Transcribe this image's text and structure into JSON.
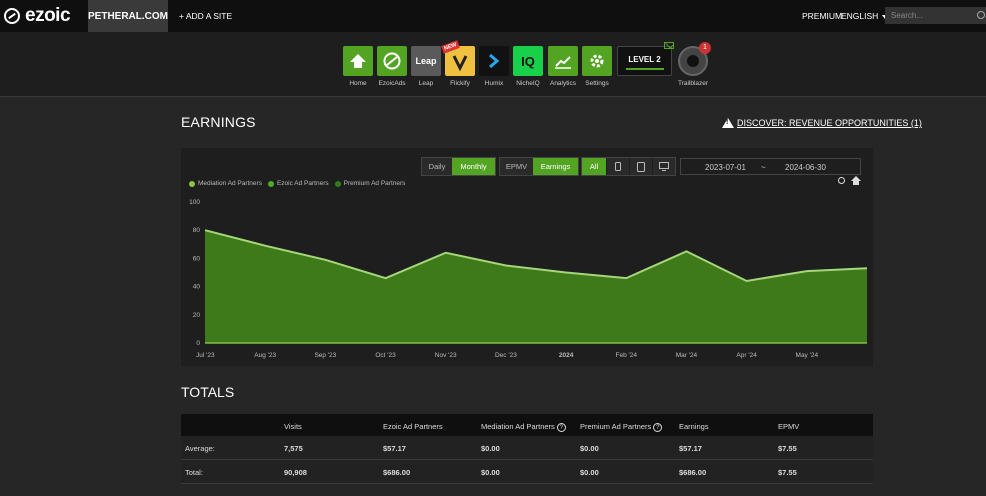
{
  "topbar": {
    "brand": "ezoic",
    "site": "PETHERAL.COM",
    "add_site": "+ ADD A SITE",
    "premium": "PREMIUM",
    "language": "ENGLISH",
    "search_placeholder": "Search..."
  },
  "apps": [
    {
      "label": "Home",
      "icon": "home-icon"
    },
    {
      "label": "EzoicAds",
      "icon": "ezoicads-icon"
    },
    {
      "label": "Leap",
      "icon": "leap-icon",
      "text": "Leap"
    },
    {
      "label": "Flickify",
      "icon": "flickify-icon",
      "badge": "NEW"
    },
    {
      "label": "Humix",
      "icon": "humix-icon"
    },
    {
      "label": "NicheIQ",
      "icon": "nicheiq-icon",
      "text": "IQ"
    },
    {
      "label": "Analytics",
      "icon": "analytics-icon"
    },
    {
      "label": "Settings",
      "icon": "gear-icon"
    }
  ],
  "level": {
    "text": "LEVEL 2"
  },
  "trailblazer": {
    "label": "Trailblazer",
    "badge": "1"
  },
  "earnings": {
    "title": "EARNINGS",
    "discover": "DISCOVER: REVENUE OPPORTUNITIES (1)",
    "controls": {
      "daily": "Daily",
      "monthly": "Monthly",
      "epmv": "EPMV",
      "earnings": "Earnings",
      "all": "All"
    },
    "date_start": "2023-07-01",
    "date_sep": "~",
    "date_end": "2024-06-30",
    "accent": "#54a424"
  },
  "chart_data": {
    "type": "area",
    "categories": [
      "Jul '23",
      "Aug '23",
      "Sep '23",
      "Oct '23",
      "Nov '23",
      "Dec '23",
      "2024",
      "Feb '24",
      "Mar '24",
      "Apr '24",
      "May '24",
      ""
    ],
    "series": [
      {
        "name": "Mediation Ad Partners",
        "color": "#8bc34a",
        "values": [
          0,
          0,
          0,
          0,
          0,
          0,
          0,
          0,
          0,
          0,
          0,
          0
        ]
      },
      {
        "name": "Ezoic Ad Partners",
        "color": "#4caf2a",
        "values": [
          80,
          69,
          59,
          46,
          64,
          55,
          50,
          46,
          65,
          44,
          51,
          53
        ]
      },
      {
        "name": "Premium Ad Partners",
        "color": "#2e7d1e",
        "values": [
          0,
          0,
          0,
          0,
          0,
          0,
          0,
          0,
          0,
          0,
          0,
          0
        ]
      }
    ],
    "yticks": [
      0,
      20,
      40,
      60,
      80,
      100
    ],
    "ylim": [
      0,
      100
    ]
  },
  "totals": {
    "title": "TOTALS",
    "headers": [
      "",
      "Visits",
      "Ezoic Ad Partners",
      "Mediation Ad Partners",
      "Premium Ad Partners",
      "Earnings",
      "EPMV"
    ],
    "rows": [
      [
        "Average:",
        "7,575",
        "$57.17",
        "$0.00",
        "$0.00",
        "$57.17",
        "$7.55"
      ],
      [
        "Total:",
        "90,908",
        "$686.00",
        "$0.00",
        "$0.00",
        "$686.00",
        "$7.55"
      ]
    ]
  }
}
